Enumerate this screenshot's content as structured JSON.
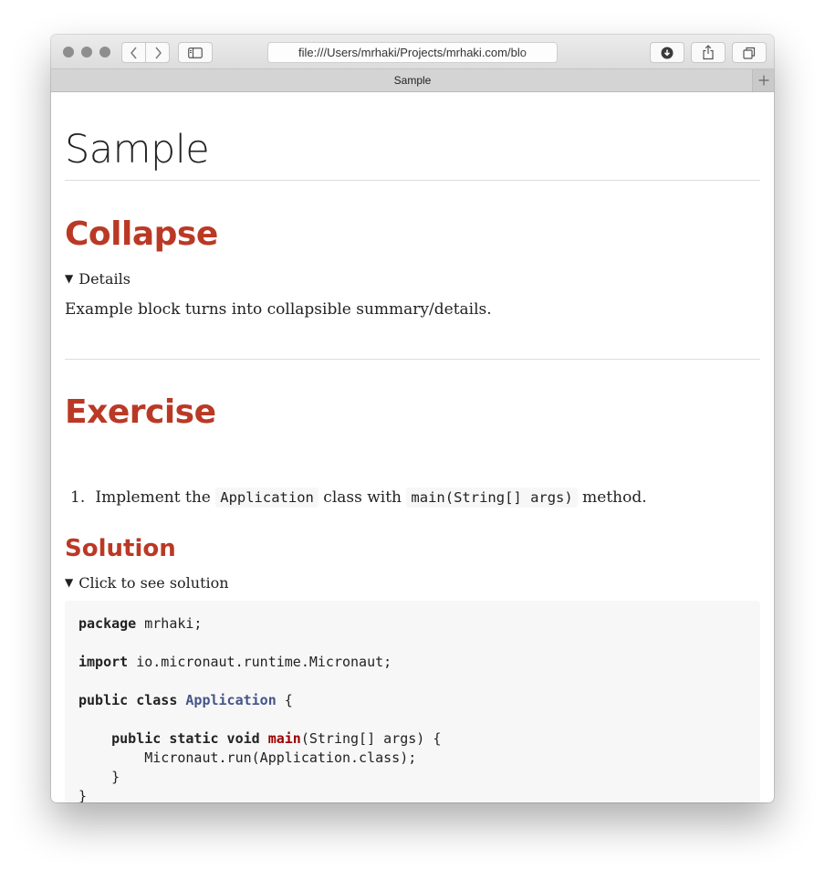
{
  "browser": {
    "address_text": "file:///Users/mrhaki/Projects/mrhaki.com/blo",
    "tab_title": "Sample"
  },
  "doc": {
    "title": "Sample",
    "sections": {
      "collapse": {
        "heading": "Collapse",
        "summary": "Details",
        "body": "Example block turns into collapsible summary/details."
      },
      "exercise": {
        "heading": "Exercise",
        "item_number": "1.",
        "item_pre": "Implement the",
        "item_code1": "Application",
        "item_mid": "class with",
        "item_code2": "main(String[] args)",
        "item_post": "method."
      },
      "solution": {
        "heading": "Solution",
        "summary": "Click to see solution"
      }
    },
    "code": {
      "l1_kw": "package",
      "l1_rest": " mrhaki;",
      "l2_kw": "import",
      "l2_rest": " io.micronaut.runtime.Micronaut;",
      "l3_kw": "public class",
      "l3_cls": "Application",
      "l3_rest": " {",
      "l4_indent": "    ",
      "l4_kw": "public static void",
      "l4_fn": "main",
      "l4_rest": "(String[] args) {",
      "l5": "        Micronaut.run(Application.class);",
      "l6": "    }",
      "l7": "}"
    }
  }
}
